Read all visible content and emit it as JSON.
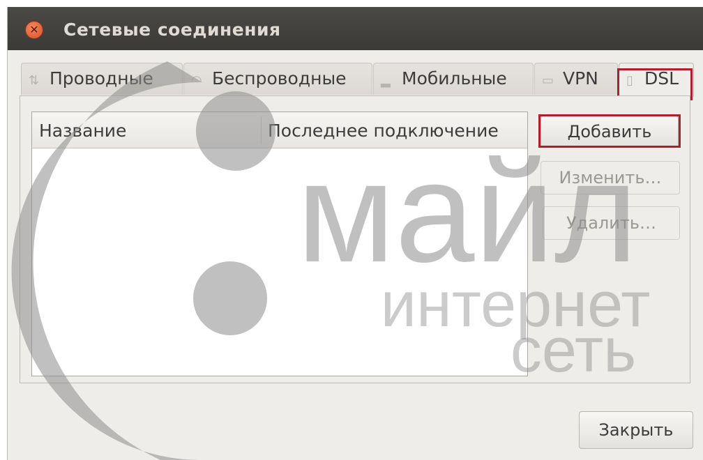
{
  "window": {
    "title": "Сетевые соединения",
    "close_glyph": "✕"
  },
  "tabs": [
    {
      "label": "Проводные",
      "icon": "wired-network-icon"
    },
    {
      "label": "Беспроводные",
      "icon": "wifi-icon"
    },
    {
      "label": "Мобильные",
      "icon": "signal-bars-icon"
    },
    {
      "label": "VPN",
      "icon": "lock-icon"
    },
    {
      "label": "DSL",
      "icon": "dsl-modem-icon",
      "active": true
    }
  ],
  "connections_table": {
    "columns": [
      "Название",
      "Последнее подключение"
    ],
    "rows": []
  },
  "side_buttons": {
    "add": "Добавить",
    "edit": "Изменить…",
    "delete": "Удалить…"
  },
  "footer": {
    "close": "Закрыть"
  },
  "watermark": {
    "line1": "майл",
    "line2": "интернет",
    "line3": "сеть"
  },
  "colors": {
    "highlight": "#b0202c",
    "titlebar": "#3d3c38",
    "close_button": "#e8683c"
  }
}
